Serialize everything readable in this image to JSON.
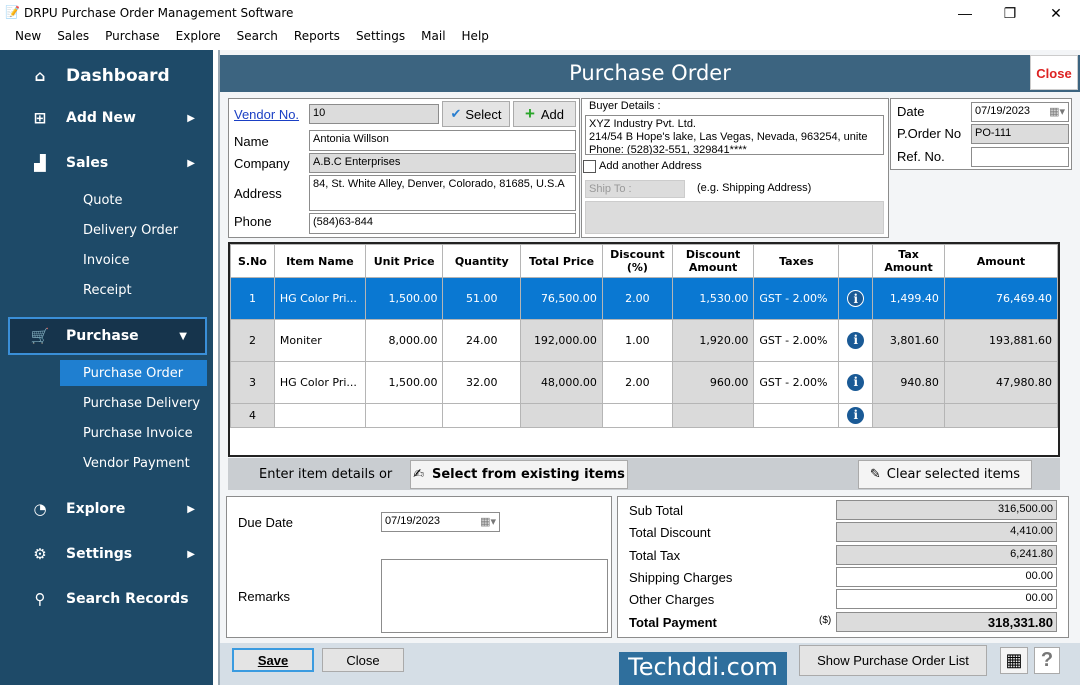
{
  "app": {
    "title": "DRPU Purchase Order Management Software",
    "win_controls": [
      "—",
      "❐",
      "✕"
    ]
  },
  "menu": [
    "New",
    "Sales",
    "Purchase",
    "Explore",
    "Search",
    "Reports",
    "Settings",
    "Mail",
    "Help"
  ],
  "sidebar": {
    "items": [
      {
        "label": "Dashboard",
        "icon": "home-icon"
      },
      {
        "label": "Add New",
        "icon": "add-document-icon"
      },
      {
        "label": "Sales",
        "icon": "chart-icon"
      },
      {
        "label": "Purchase",
        "icon": "cart-icon"
      },
      {
        "label": "Explore",
        "icon": "explore-icon"
      },
      {
        "label": "Settings",
        "icon": "gear-icon"
      },
      {
        "label": "Search Records",
        "icon": "search-icon"
      }
    ],
    "sales_sub": [
      "Quote",
      "Delivery Order",
      "Invoice",
      "Receipt"
    ],
    "purchase_sub": [
      "Purchase Order",
      "Purchase Delivery",
      "Purchase Invoice",
      "Vendor Payment"
    ]
  },
  "header": {
    "title": "Purchase Order",
    "close": "Close"
  },
  "vendor": {
    "vendor_no_label": "Vendor No.",
    "vendor_no": "10",
    "select": "Select",
    "add": "Add",
    "name_label": "Name",
    "name": "Antonia Willson",
    "company_label": "Company",
    "company": "A.B.C  Enterprises",
    "address_label": "Address",
    "address": "84, St. White Alley, Denver, Colorado, 81685, U.S.A",
    "phone_label": "Phone",
    "phone": "(584)63-844"
  },
  "buyer": {
    "label": "Buyer Details :",
    "line1": "XYZ Industry Pvt. Ltd.",
    "line2": "214/54 B Hope's lake, Las Vegas, Nevada, 963254, unite",
    "line3": "Phone: (528)32-551, 329841****",
    "add_address": "Add another Address",
    "ship_to": "Ship To :",
    "ship_hint": "(e.g. Shipping Address)"
  },
  "order": {
    "date_label": "Date",
    "date": "07/19/2023",
    "po_label": "P.Order No",
    "po": "PO-111",
    "ref_label": "Ref. No.",
    "ref": ""
  },
  "table": {
    "headers": [
      "S.No",
      "Item Name",
      "Unit Price",
      "Quantity",
      "Total Price",
      "Discount (%)",
      "Discount Amount",
      "Taxes",
      "",
      "Tax Amount",
      "Amount"
    ],
    "rows": [
      [
        "1",
        "HG Color Pri...",
        "1,500.00",
        "51.00",
        "76,500.00",
        "2.00",
        "1,530.00",
        "GST - 2.00%",
        "i",
        "1,499.40",
        "76,469.40"
      ],
      [
        "2",
        "Moniter",
        "8,000.00",
        "24.00",
        "192,000.00",
        "1.00",
        "1,920.00",
        "GST - 2.00%",
        "i",
        "3,801.60",
        "193,881.60"
      ],
      [
        "3",
        "HG Color Pri...",
        "1,500.00",
        "32.00",
        "48,000.00",
        "2.00",
        "960.00",
        "GST - 2.00%",
        "i",
        "940.80",
        "47,980.80"
      ],
      [
        "4",
        "",
        "",
        "",
        "",
        "",
        "",
        "",
        "i",
        "",
        ""
      ]
    ]
  },
  "strip": {
    "enter": "Enter item details or",
    "select_existing": "Select from existing items",
    "clear": "Clear selected items"
  },
  "bottom": {
    "due_label": "Due Date",
    "due": "07/19/2023",
    "remarks_label": "Remarks"
  },
  "totals": {
    "sub_label": "Sub Total",
    "sub": "316,500.00",
    "disc_label": "Total Discount",
    "disc": "4,410.00",
    "tax_label": "Total Tax",
    "tax": "6,241.80",
    "ship_label": "Shipping Charges",
    "ship": "00.00",
    "other_label": "Other Charges",
    "other": "00.00",
    "pay_label": "Total Payment",
    "currency": "($)",
    "pay": "318,331.80"
  },
  "footer": {
    "save": "Save",
    "close": "Close",
    "watermark": "Techddi.com",
    "show_list": "Show Purchase Order List"
  }
}
